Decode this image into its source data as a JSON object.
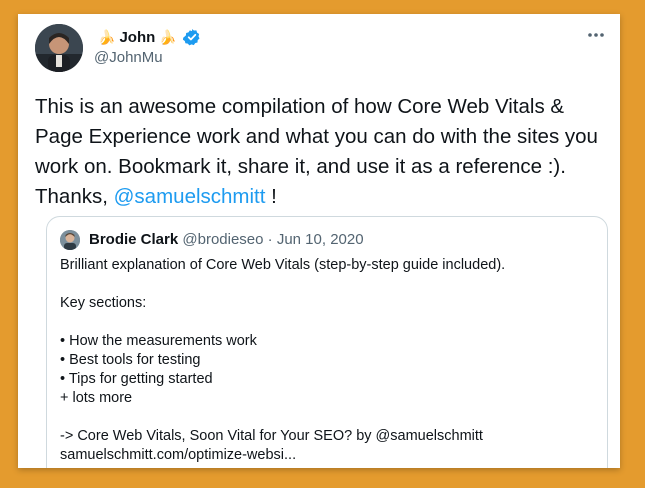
{
  "tweet": {
    "name": "John",
    "handle": "@JohnMu",
    "text_before": "This is an awesome compilation of how Core Web Vitals & Page Experience work and what you can do with the sites you work on. Bookmark it, share it, and use it as a reference :). Thanks, ",
    "mention": "@samuelschmitt",
    "text_after": " !",
    "name_emoji": "🍌",
    "icons": {
      "verified": "verified-badge-icon",
      "more": "more-dots-icon"
    },
    "colors": {
      "accent": "#1d9bf0",
      "background": "#E49B2E"
    }
  },
  "quote": {
    "name": "Brodie Clark",
    "handle": "@brodieseo",
    "separator": " · ",
    "date": "Jun 10, 2020",
    "lines": [
      "Brilliant explanation of Core Web Vitals (step-by-step guide included).",
      "",
      "Key sections:",
      "",
      "• How the measurements work",
      "• Best tools for testing",
      "• Tips for getting started",
      "+ lots more",
      "",
      "-> Core Web Vitals, Soon Vital for Your SEO? by @samuelschmitt",
      "samuelschmitt.com/optimize-websi..."
    ]
  }
}
